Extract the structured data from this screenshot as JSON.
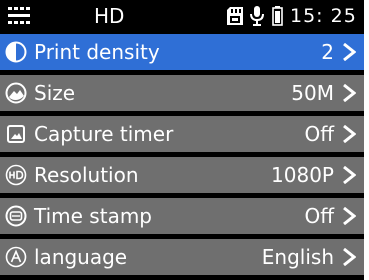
{
  "status_bar": {
    "mode_label": "HD",
    "time": "15: 25",
    "icons": [
      "menu-grid-icon",
      "sd-card-icon",
      "microphone-icon",
      "battery-icon"
    ]
  },
  "menu": {
    "items": [
      {
        "label": "Print density",
        "value": "2",
        "icon": "half-contrast-icon",
        "selected": true
      },
      {
        "label": "Size",
        "value": "50M",
        "icon": "landscape-icon",
        "selected": false
      },
      {
        "label": "Capture timer",
        "value": "Off",
        "icon": "timer-picture-icon",
        "selected": false
      },
      {
        "label": "Resolution",
        "value": "1080P",
        "icon": "hd-icon",
        "selected": false
      },
      {
        "label": "Time stamp",
        "value": "Off",
        "icon": "clock-stamp-icon",
        "selected": false
      },
      {
        "label": "language",
        "value": "English",
        "icon": "language-a-icon",
        "selected": false
      }
    ]
  },
  "colors": {
    "background": "#000000",
    "selected_row": "#2f6fd6",
    "row": "#6f6f6f",
    "text": "#ffffff"
  }
}
